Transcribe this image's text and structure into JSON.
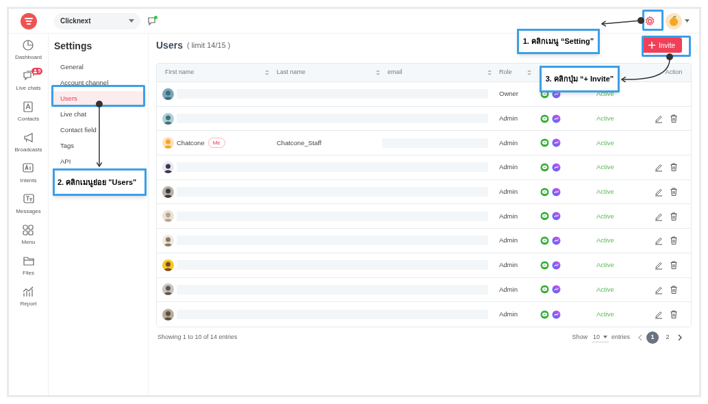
{
  "top_bar": {
    "workspace": "Clicknext"
  },
  "nav": [
    {
      "label": "Dashboard"
    },
    {
      "label": "Live chats",
      "badge": "5"
    },
    {
      "label": "Contacts"
    },
    {
      "label": "Broadcasts"
    },
    {
      "label": "Intents"
    },
    {
      "label": "Messages"
    },
    {
      "label": "Menu"
    },
    {
      "label": "Files"
    },
    {
      "label": "Report"
    }
  ],
  "settings": {
    "title": "Settings",
    "items": [
      {
        "label": "General",
        "selected": false
      },
      {
        "label": "Account channel",
        "selected": false
      },
      {
        "label": "Users",
        "selected": true
      },
      {
        "label": "Live chat",
        "selected": false
      },
      {
        "label": "Contact field",
        "selected": false
      },
      {
        "label": "Tags",
        "selected": false
      },
      {
        "label": "API",
        "selected": false
      }
    ]
  },
  "page": {
    "title": "Users",
    "limit": "( limit 14/15 )",
    "invite_button": "Invite"
  },
  "table": {
    "columns": [
      "First name",
      "Last name",
      "email",
      "Role"
    ],
    "action_column": "Action",
    "rows": [
      {
        "name_redacted": true,
        "role": "Owner",
        "status": "Active",
        "editable": false
      },
      {
        "name_redacted": true,
        "role": "Admin",
        "status": "Active",
        "editable": true
      },
      {
        "name_redacted": false,
        "first_name": "Chatcone",
        "badge": "Me",
        "last_name": "Chatcone_Staff",
        "role": "Admin",
        "status": "Active",
        "editable": false
      },
      {
        "name_redacted": true,
        "role": "Admin",
        "status": "Active",
        "editable": true
      },
      {
        "name_redacted": true,
        "role": "Admin",
        "status": "Active",
        "editable": true
      },
      {
        "name_redacted": true,
        "role": "Admin",
        "status": "Active",
        "editable": true
      },
      {
        "name_redacted": true,
        "role": "Admin",
        "status": "Active",
        "editable": true
      },
      {
        "name_redacted": true,
        "role": "Admin",
        "status": "Active",
        "editable": true
      },
      {
        "name_redacted": true,
        "role": "Admin",
        "status": "Active",
        "editable": true
      },
      {
        "name_redacted": true,
        "role": "Admin",
        "status": "Active",
        "editable": true
      }
    ]
  },
  "footer": {
    "showing": "Showing 1 to 10 of 14 entries",
    "show_label": "Show",
    "page_size": "10",
    "entries_label": "entries",
    "pages": [
      {
        "label": "1",
        "selected": true
      },
      {
        "label": "2",
        "selected": false
      }
    ]
  },
  "annotations": [
    "1. คลิกเมนู “Setting”",
    "2. คลิกเมนูย่อย \"Users\"",
    "3. คลิกปุ่ม “+ Invite”"
  ]
}
